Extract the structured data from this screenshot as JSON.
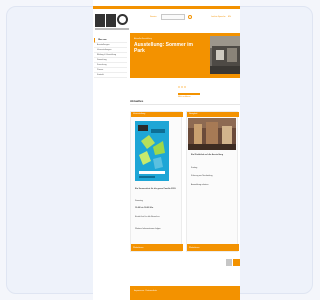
{
  "header": {
    "logo_text": "PULS",
    "nav_left": "Service",
    "search_placeholder": "Suche",
    "lang_right": "Leichte Sprache",
    "lang_short": "EN"
  },
  "sidebar": {
    "items": [
      "Über uns",
      "Ausstellungen",
      "Veranstaltungen",
      "Bildung & Vermittlung",
      "Sammlung",
      "Forschung",
      "Presse",
      "Kontakt"
    ]
  },
  "hero": {
    "kicker": "Aktuelle Ausstellung",
    "title": "Ausstellung: Sommer im Park"
  },
  "band_label": "Mehr erfahren",
  "section_title": "Aktuelles",
  "teasers": [
    {
      "head": "Veranstaltung",
      "lines": [
        "Ein Sommerfest für die ganze Familie 2019",
        "Samstag",
        "10:00 bis 18:00 Uhr",
        "Eintritt frei für alle Besucher",
        "Weitere Informationen folgen"
      ],
      "foot": "Weiterlesen"
    },
    {
      "head": "Neuigkeit",
      "lines": [
        "Ein Rückblick auf die Ausstellung",
        "Freitag",
        "Führung am Nachmittag",
        "Anmeldung erbeten"
      ],
      "foot": "Weiterlesen"
    }
  ],
  "footer": {
    "label": "Impressum · Datenschutz"
  },
  "colors": {
    "accent": "#f39200",
    "frame": "#eef2fa"
  },
  "icons": {
    "search": "search-icon"
  }
}
